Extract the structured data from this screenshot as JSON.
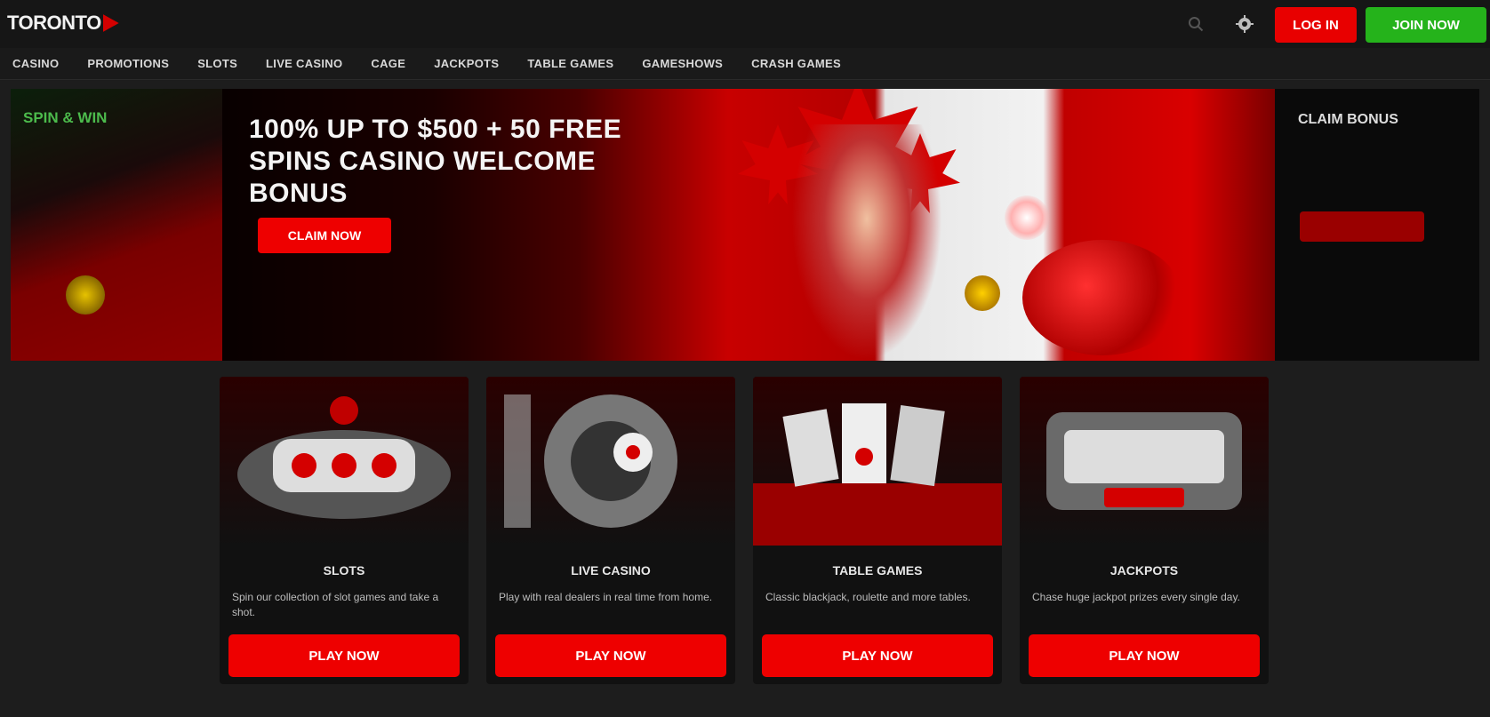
{
  "header": {
    "logo_text": "TORONTO",
    "login_label": "LOG IN",
    "join_label": "JOIN NOW",
    "search_icon": "search-icon",
    "settings_icon": "gear-icon"
  },
  "nav": {
    "items": [
      {
        "label": "CASINO"
      },
      {
        "label": "PROMOTIONS"
      },
      {
        "label": "SLOTS"
      },
      {
        "label": "LIVE CASINO"
      },
      {
        "label": "CAGE"
      },
      {
        "label": "JACKPOTS"
      },
      {
        "label": "TABLE GAMES"
      },
      {
        "label": "GAMESHOWS"
      },
      {
        "label": "CRASH GAMES"
      }
    ]
  },
  "hero": {
    "left_text": "SPIN & WIN",
    "title": "100% UP TO $500 + 50 FREE SPINS CASINO WELCOME BONUS",
    "cta_label": "CLAIM NOW",
    "right_text": "CLAIM BONUS"
  },
  "cards": [
    {
      "title": "SLOTS",
      "desc": "Spin our collection of slot games and take a shot.",
      "button": "PLAY NOW"
    },
    {
      "title": "LIVE CASINO",
      "desc": "Play with real dealers in real time from home.",
      "button": "PLAY NOW"
    },
    {
      "title": "TABLE GAMES",
      "desc": "Classic blackjack, roulette and more tables.",
      "button": "PLAY NOW"
    },
    {
      "title": "JACKPOTS",
      "desc": "Chase huge jackpot prizes every single day.",
      "button": "PLAY NOW"
    }
  ],
  "colors": {
    "accent": "#e80000",
    "join": "#25b31b",
    "background": "#1d1d1d"
  }
}
